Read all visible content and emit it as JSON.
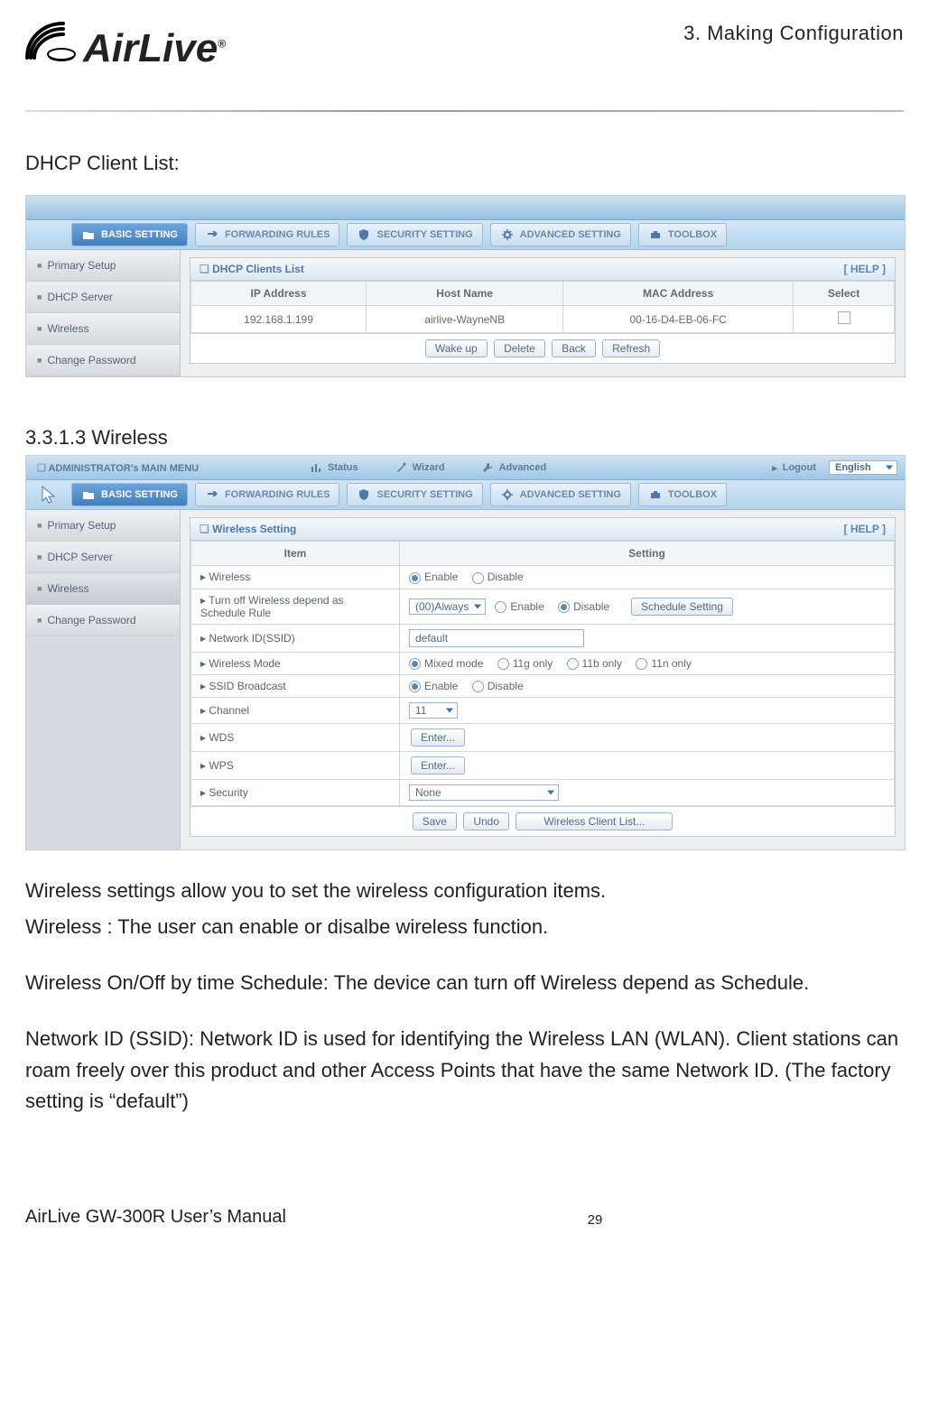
{
  "header": {
    "logo_text": "AirLive",
    "logo_tm": "®",
    "chapter": "3. Making Configuration"
  },
  "text": {
    "dhcp_heading": "DHCP Client List:",
    "wireless_heading": "3.3.1.3 Wireless",
    "para1": "Wireless settings allow you to set the wireless configuration items.",
    "para2": "Wireless : The user can enable or disalbe wireless function.",
    "para3": "Wireless On/Off by time Schedule: The device can turn off Wireless depend as Schedule.",
    "para4": "Network ID (SSID): Network ID is used for identifying the Wireless LAN (WLAN). Client stations can roam freely over this product and other Access Points that have the same Network ID. (The factory setting is “default”)"
  },
  "tabs": {
    "basic": "BASIC SETTING",
    "forwarding": "FORWARDING RULES",
    "security": "SECURITY SETTING",
    "advanced": "ADVANCED SETTING",
    "toolbox": "TOOLBOX"
  },
  "sidebar": {
    "primary": "Primary Setup",
    "dhcp": "DHCP Server",
    "wireless": "Wireless",
    "change_pw": "Change Password"
  },
  "dhcp_panel": {
    "title": "DHCP Clients List",
    "help": "[ HELP ]",
    "cols": {
      "ip": "IP Address",
      "host": "Host Name",
      "mac": "MAC Address",
      "select": "Select"
    },
    "row": {
      "ip": "192.168.1.199",
      "host": "airlive-WayneNB",
      "mac": "00-16-D4-EB-06-FC"
    },
    "buttons": {
      "wake": "Wake up",
      "delete": "Delete",
      "back": "Back",
      "refresh": "Refresh"
    }
  },
  "admin_bar": {
    "title": "ADMINISTRATOR's MAIN MENU",
    "status": "Status",
    "wizard": "Wizard",
    "advanced": "Advanced",
    "logout": "Logout",
    "language": "English"
  },
  "wireless_panel": {
    "title": "Wireless Setting",
    "help": "[ HELP ]",
    "col_item": "Item",
    "col_setting": "Setting",
    "items": {
      "wireless": "Wireless",
      "turn_off": "Turn off Wireless depend as Schedule Rule",
      "ssid": "Network ID(SSID)",
      "mode": "Wireless Mode",
      "broadcast": "SSID Broadcast",
      "channel": "Channel",
      "wds": "WDS",
      "wps": "WPS",
      "security": "Security"
    },
    "values": {
      "enable": "Enable",
      "disable": "Disable",
      "always": "(00)Always",
      "schedule_btn": "Schedule Setting",
      "ssid_value": "default",
      "mode_mixed": "Mixed mode",
      "mode_11g": "11g only",
      "mode_11b": "11b only",
      "mode_11n": "11n only",
      "channel_value": "11",
      "enter": "Enter...",
      "security_value": "None"
    },
    "buttons": {
      "save": "Save",
      "undo": "Undo",
      "client_list": "Wireless Client List..."
    }
  },
  "footer": {
    "manual": "AirLive GW-300R User’s Manual",
    "page": "29"
  }
}
